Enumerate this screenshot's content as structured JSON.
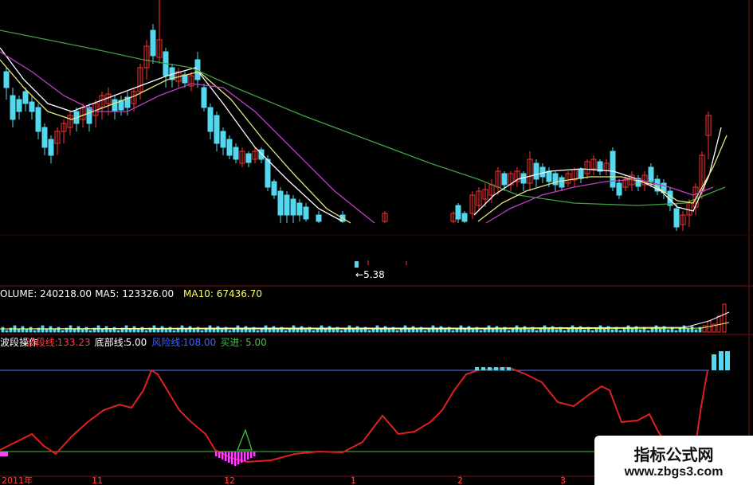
{
  "chart_data": {
    "type": "candlestick-multi-panel",
    "price_panel": {
      "low_marker": "5.38",
      "moving_averages_colors": [
        "#ffffff",
        "#e6e680",
        "#c040c0",
        "#40a040"
      ]
    },
    "volume_panel": {
      "legend": [
        {
          "text": "OLUME: 240218.00",
          "color": "#ffffff"
        },
        {
          "text": "MA5: 123326.00",
          "color": "#ffffff"
        },
        {
          "text": "MA10: 67436.70",
          "color": "#ffff66"
        }
      ]
    },
    "indicator_panel": {
      "legend": [
        {
          "text": "波段操作",
          "color": "#ffffff"
        },
        {
          "text": "波段线:",
          "color": "#ff4040"
        },
        {
          "text": "133.23",
          "color": "#ff4040"
        },
        {
          "text": "底部线:",
          "color": "#ffffff"
        },
        {
          "text": "5.00",
          "color": "#ffffff"
        },
        {
          "text": "风险线:",
          "color": "#4060ff"
        },
        {
          "text": "108.00",
          "color": "#4060ff"
        },
        {
          "text": "买进:",
          "color": "#40c040"
        },
        {
          "text": "5.00",
          "color": "#40c040"
        }
      ],
      "bottom_line": 5,
      "risk_line": 108
    },
    "x_axis_ticks": [
      "2011年",
      "11",
      "12",
      "1",
      "2",
      "3"
    ]
  },
  "watermark": {
    "cn": "指标公式网",
    "url": "www.zbgs3.com"
  }
}
